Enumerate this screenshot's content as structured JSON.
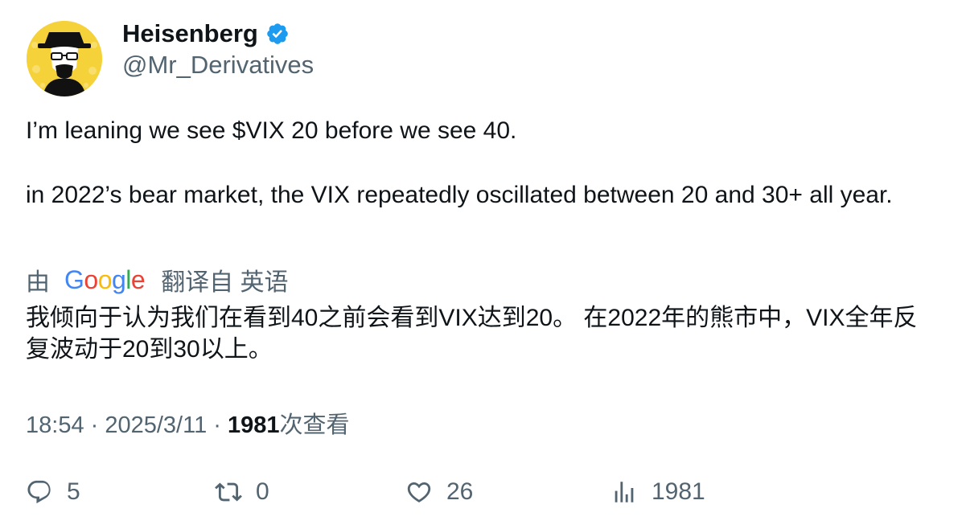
{
  "author": {
    "display_name": "Heisenberg",
    "handle": "@Mr_Derivatives",
    "verified": true,
    "avatar_icon": "heisenberg-avatar",
    "avatar_bg": "#f6d23a"
  },
  "tweet": {
    "paragraphs": [
      "I’m leaning we see $VIX 20 before we see 40.",
      "in 2022’s bear market, the VIX repeatedly oscillated between 20 and 30+ all year."
    ]
  },
  "translation": {
    "by_label": "由",
    "provider": "Google",
    "from_label": "翻译自 英语",
    "text": "我倾向于认为我们在看到40之前会看到VIX达到20。 在2022年的熊市中，VIX全年反复波动于20到30以上。"
  },
  "meta": {
    "time": "18:54",
    "separator": " · ",
    "date": "2025/3/11",
    "views_count": "1981",
    "views_label": "次查看"
  },
  "actions": {
    "reply": {
      "icon": "reply-icon",
      "count": "5"
    },
    "retweet": {
      "icon": "retweet-icon",
      "count": "0"
    },
    "like": {
      "icon": "heart-icon",
      "count": "26"
    },
    "views": {
      "icon": "analytics-icon",
      "count": "1981"
    }
  },
  "colors": {
    "text": "#0f1419",
    "secondary": "#536471",
    "verified": "#1d9bf0"
  }
}
